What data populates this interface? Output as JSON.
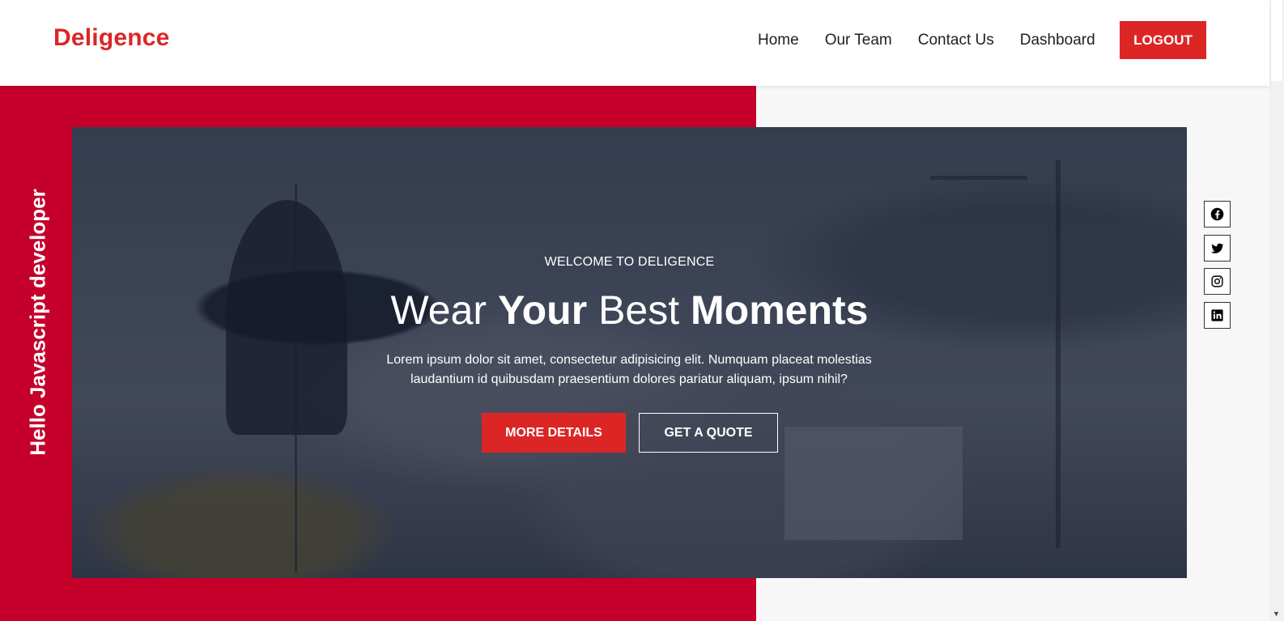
{
  "brand": {
    "name": "Deligence",
    "color": "#dc2626"
  },
  "nav": {
    "items": [
      {
        "label": "Home"
      },
      {
        "label": "Our Team"
      },
      {
        "label": "Contact Us"
      },
      {
        "label": "Dashboard"
      }
    ],
    "logout_label": "LOGOUT"
  },
  "sidebar": {
    "vertical_text": "Hello Javascript developer"
  },
  "hero": {
    "eyebrow": "WELCOME TO DELIGENCE",
    "headline": {
      "w1": "Wear",
      "w2": "Your",
      "w3": "Best",
      "w4": "Moments"
    },
    "description": "Lorem ipsum dolor sit amet, consectetur adipisicing elit. Numquam placeat molestias laudantium id quibusdam praesentium dolores pariatur aliquam, ipsum nihil?",
    "primary_button": "MORE DETAILS",
    "secondary_button": "GET A QUOTE"
  },
  "social": [
    {
      "icon": "facebook-icon"
    },
    {
      "icon": "twitter-icon"
    },
    {
      "icon": "instagram-icon"
    },
    {
      "icon": "linkedin-icon"
    }
  ],
  "colors": {
    "accent": "#dc2626",
    "panel_red": "#c4002b",
    "panel_gray": "#f7f7f7"
  }
}
